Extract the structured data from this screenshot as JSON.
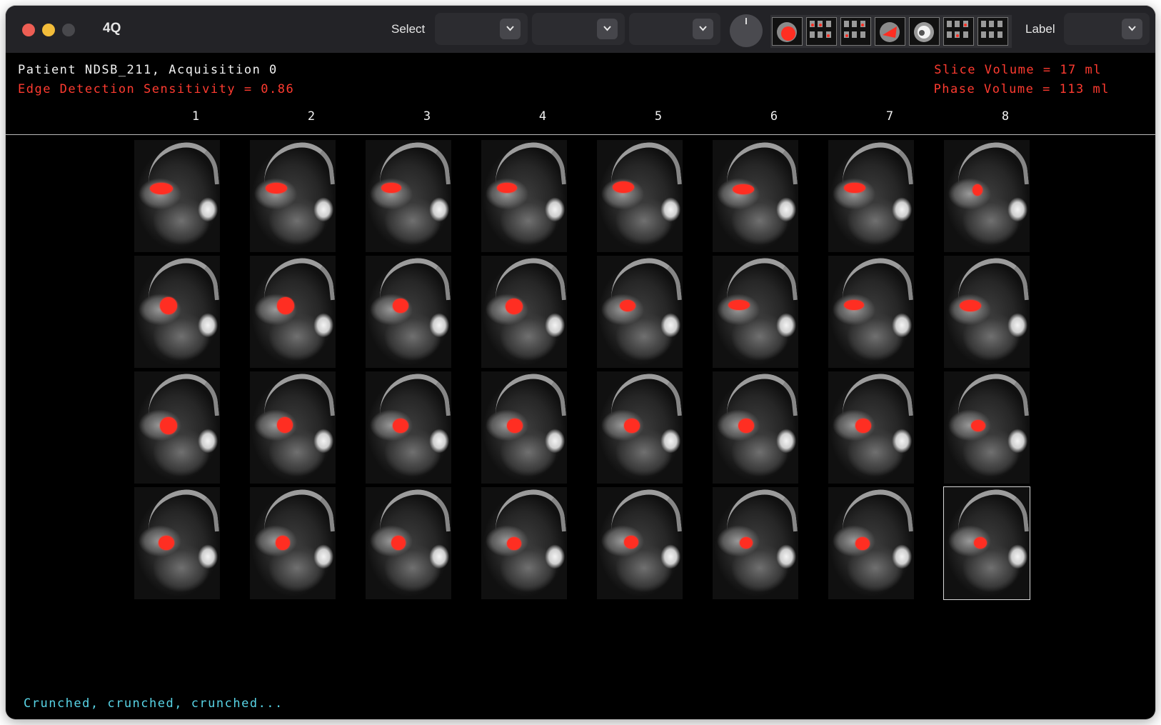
{
  "window": {
    "title": "4Q"
  },
  "toolbar": {
    "select_label": "Select",
    "label_label": "Label"
  },
  "selects": [
    {
      "value": ""
    },
    {
      "value": ""
    },
    {
      "value": ""
    },
    {
      "value": ""
    }
  ],
  "thumbnails": [
    "thumb-heart-red",
    "thumb-grid",
    "thumb-grid",
    "thumb-heart-red",
    "thumb-heart-white",
    "thumb-grid",
    "thumb-grid"
  ],
  "info": {
    "patient": "Patient NDSB_211, Acquisition 0",
    "sensitivity": "Edge Detection Sensitivity = 0.86",
    "slice_volume": "Slice Volume = 17 ml",
    "phase_volume": "Phase Volume = 113 ml"
  },
  "columns": [
    "1",
    "2",
    "3",
    "4",
    "5",
    "6",
    "7",
    "8"
  ],
  "grid": {
    "rows": 4,
    "selected": {
      "row": 4,
      "col": 8
    }
  },
  "status": "Crunched, crunched, crunched...",
  "colors": {
    "segmentation": "#ff2e22",
    "info_text": "#ff3b30",
    "status_text": "#58d4e6",
    "window_bg": "#000000"
  }
}
